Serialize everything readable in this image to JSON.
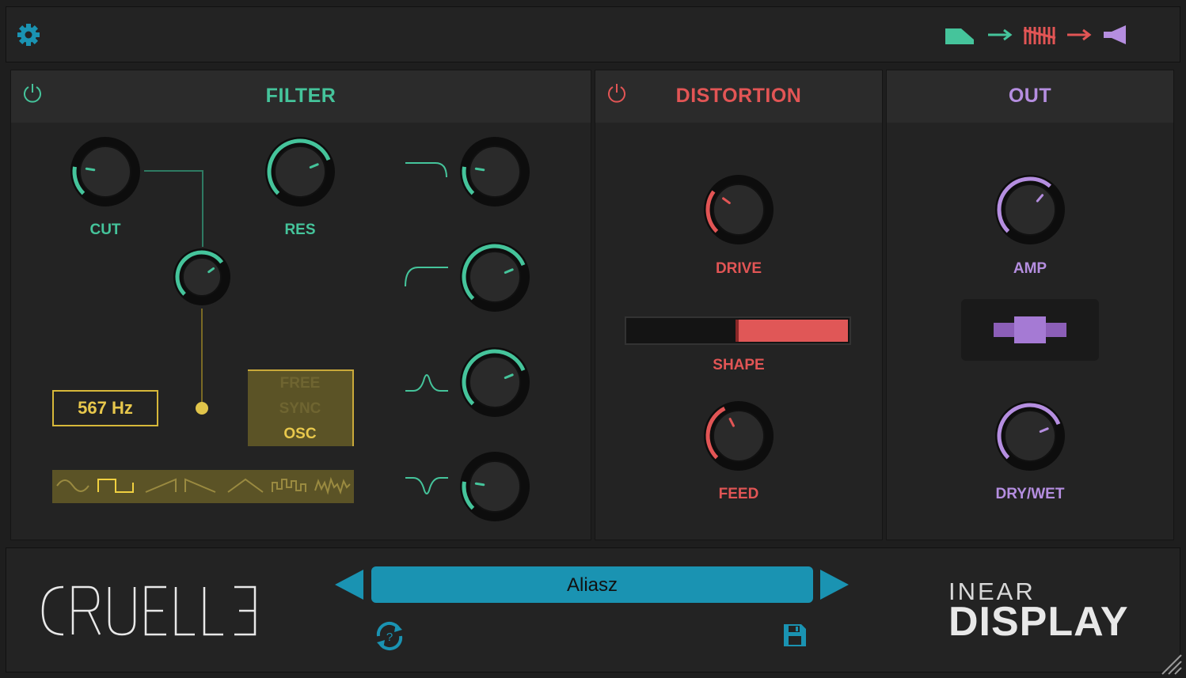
{
  "colors": {
    "filter": "#45c49b",
    "distortion": "#e25555",
    "out": "#b58ee0",
    "lfo": "#e0c44a",
    "preset_bar": "#1a93b2"
  },
  "topbar": {
    "settings_icon": "gear-icon",
    "signal_chain": [
      "filter-icon",
      "arrow-right-icon",
      "distortion-icon",
      "arrow-right-icon",
      "speaker-icon"
    ]
  },
  "filter": {
    "title": "FILTER",
    "cut_label": "CUT",
    "res_label": "RES",
    "lfo_freq": "567 Hz",
    "lfo_modes": [
      "FREE",
      "SYNC",
      "OSC"
    ],
    "lfo_mode_selected": "OSC",
    "waveforms": [
      "sine",
      "square",
      "saw-up",
      "saw-down",
      "triangle",
      "random",
      "noise"
    ],
    "waveform_selected": "square",
    "knob_levels": {
      "cut": 0.2,
      "res": 0.75,
      "lfo_depth": 0.7
    },
    "filter_types": [
      {
        "type": "lowpass",
        "level": 0.2
      },
      {
        "type": "highpass",
        "level": 0.75
      },
      {
        "type": "bandpass",
        "level": 0.75
      },
      {
        "type": "notch",
        "level": 0.2
      }
    ]
  },
  "distortion": {
    "title": "DISTORTION",
    "drive_label": "DRIVE",
    "shape_label": "SHAPE",
    "feed_label": "FEED",
    "drive_level": 0.3,
    "feed_level": 0.4,
    "shape_level": 0.5
  },
  "out": {
    "title": "OUT",
    "amp_label": "AMP",
    "drywet_label": "DRY/WET",
    "amp_level": 0.65,
    "drywet_level": 0.75
  },
  "footer": {
    "product_logo": "CRUELLE",
    "preset_name": "Aliasz",
    "brand_line1": "INEAR",
    "brand_line2": "DISPLAY"
  }
}
